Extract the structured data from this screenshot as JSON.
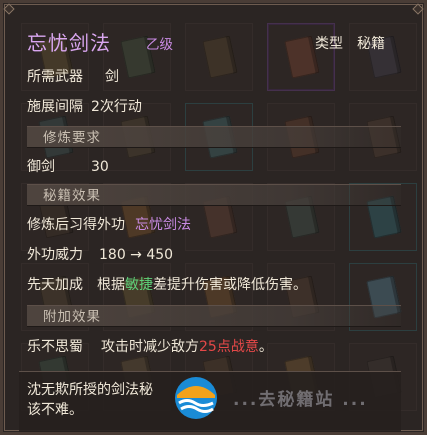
{
  "skill": {
    "name": "忘忧剑法",
    "grade": "乙级",
    "type_label": "类型",
    "type_value": "秘籍"
  },
  "info": {
    "weapon_label": "所需武器",
    "weapon_value": "剑",
    "interval_label": "施展间隔",
    "interval_value": "2次行动"
  },
  "requirements": {
    "header": "修炼要求",
    "items": [
      {
        "label": "御剑",
        "value": "30"
      }
    ]
  },
  "effects": {
    "header": "秘籍效果",
    "learn_label": "修炼后习得外功",
    "learn_value": "忘忧剑法",
    "power_label": "外功威力",
    "power_value": "180 → 450",
    "bonus_label": "先天加成",
    "bonus_prefix": "根据",
    "bonus_stat": "敏捷",
    "bonus_suffix": "差提升伤害或降低伤害。"
  },
  "extra": {
    "header": "附加效果",
    "effect_label": "乐不思蜀",
    "effect_prefix": "攻击时减少敌方",
    "effect_highlight": "25点战意",
    "effect_suffix": "。"
  },
  "description": {
    "line1": "沈无欺所授的剑法秘",
    "line2": "该不难。"
  },
  "watermark": {
    "text": "...去秘籍站 ..."
  },
  "colors": {
    "title": "#d9a6f0",
    "grade": "#c98be4",
    "stat_highlight": "#5fd27a",
    "damage_highlight": "#e54848",
    "panel_bg": "#2b2523"
  }
}
